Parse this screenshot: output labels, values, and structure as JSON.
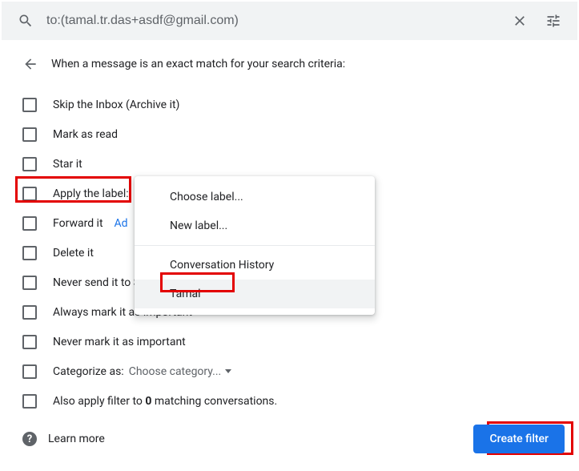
{
  "search": {
    "value": "to:(tamal.tr.das+asdf@gmail.com)"
  },
  "header": {
    "text": "When a message is an exact match for your search criteria:"
  },
  "options": {
    "skip_inbox": "Skip the Inbox (Archive it)",
    "mark_read": "Mark as read",
    "star_it": "Star it",
    "apply_label": "Apply the label:",
    "forward_it": "Forward it",
    "forward_add": "Ad",
    "delete_it": "Delete it",
    "never_spam": "Never send it to S",
    "always_important": "Always mark it as important",
    "never_important": "Never mark it as important",
    "categorize_as": "Categorize as:",
    "choose_category": "Choose category...",
    "also_apply_prefix": "Also apply filter to ",
    "zero": "0",
    "also_apply_suffix": " matching conversations."
  },
  "menu": {
    "choose_label": "Choose label...",
    "new_label": "New label...",
    "conversation_history": "Conversation History",
    "tamal": "Tamal"
  },
  "footer": {
    "learn_more": "Learn more",
    "create_filter": "Create filter"
  }
}
